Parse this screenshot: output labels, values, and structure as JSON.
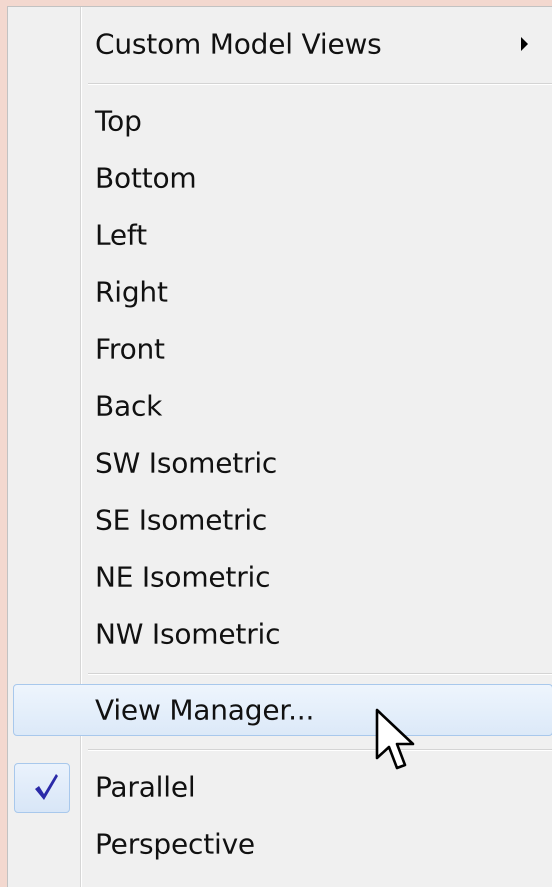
{
  "menu": {
    "custom_views": {
      "label": "Custom Model Views",
      "submenu_icon": "chevron-right-icon"
    },
    "views": [
      {
        "label": "Top"
      },
      {
        "label": "Bottom"
      },
      {
        "label": "Left"
      },
      {
        "label": "Right"
      },
      {
        "label": "Front"
      },
      {
        "label": "Back"
      },
      {
        "label": "SW Isometric"
      },
      {
        "label": "SE Isometric"
      },
      {
        "label": "NE Isometric"
      },
      {
        "label": "NW Isometric"
      }
    ],
    "view_manager": {
      "label": "View Manager...",
      "highlighted": true
    },
    "projection": [
      {
        "label": "Parallel",
        "checked": true
      },
      {
        "label": "Perspective",
        "checked": false
      }
    ]
  },
  "colors": {
    "menu_background": "#f0f0f0",
    "highlight_border": "#a8c8ec",
    "check_color": "#2a2aa8",
    "outer_background": "#f3d8cf"
  },
  "icons": {
    "check": "checkmark-icon",
    "cursor": "mouse-pointer-icon"
  }
}
